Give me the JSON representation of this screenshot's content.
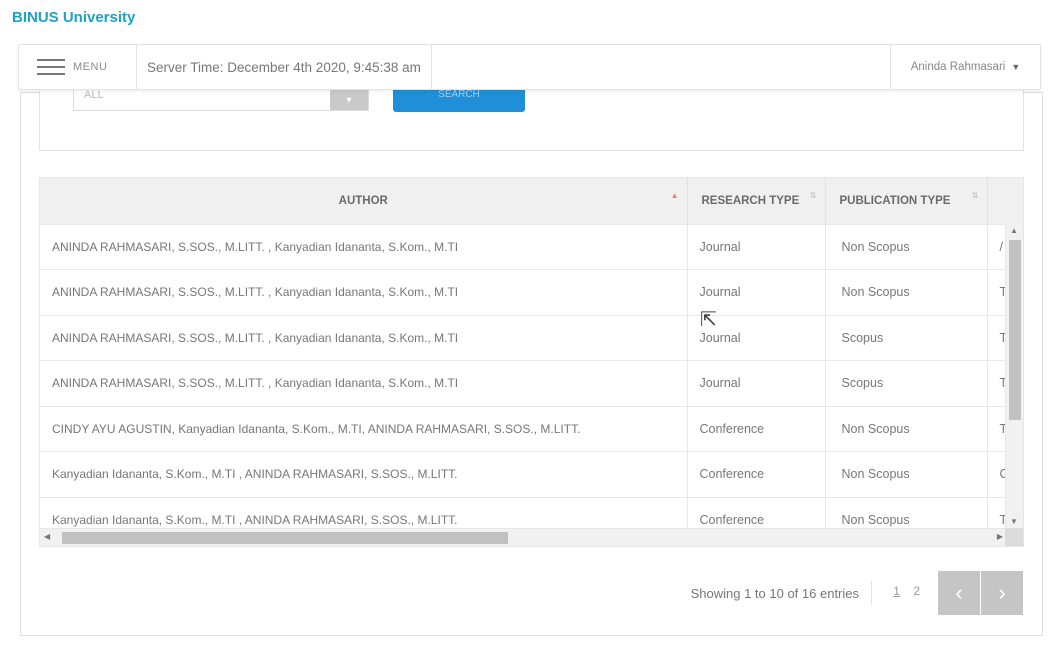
{
  "brand": {
    "name": "BINUS University"
  },
  "topbar": {
    "menu_label": "MENU",
    "server_time": "Server Time: December 4th 2020, 9:45:38 am",
    "user_name": "Aninda Rahmasari",
    "caret": "▼"
  },
  "filter": {
    "select_value": "ALL",
    "select_arrow": "▾",
    "search_label": "SEARCH"
  },
  "table": {
    "columns": [
      "AUTHOR",
      "RESEARCH TYPE",
      "PUBLICATION TYPE"
    ],
    "sort_indicators": {
      "active": "▲",
      "inactive": "⇅"
    },
    "rows": [
      {
        "author": "ANINDA RAHMASARI, S.SOS., M.LITT. , Kanyadian Idananta, S.Kom., M.TI",
        "research_type": "Journal",
        "publication_type": "Non Scopus",
        "extra": "/"
      },
      {
        "author": "ANINDA RAHMASARI, S.SOS., M.LITT. , Kanyadian Idananta, S.Kom., M.TI",
        "research_type": "Journal",
        "publication_type": "Non Scopus",
        "extra": "T"
      },
      {
        "author": "ANINDA RAHMASARI, S.SOS., M.LITT. , Kanyadian Idananta, S.Kom., M.TI",
        "research_type": "Journal",
        "publication_type": "Scopus",
        "extra": "T"
      },
      {
        "author": "ANINDA RAHMASARI, S.SOS., M.LITT. , Kanyadian Idananta, S.Kom., M.TI",
        "research_type": "Journal",
        "publication_type": "Scopus",
        "extra": "T"
      },
      {
        "author": "CINDY AYU AGUSTIN, Kanyadian Idananta, S.Kom., M.TI, ANINDA RAHMASARI, S.SOS., M.LITT.",
        "research_type": "Conference",
        "publication_type": "Non Scopus",
        "extra": "T"
      },
      {
        "author": "Kanyadian Idananta, S.Kom., M.TI , ANINDA RAHMASARI, S.SOS., M.LITT.",
        "research_type": "Conference",
        "publication_type": "Non Scopus",
        "extra": "C"
      },
      {
        "author": "Kanyadian Idananta, S.Kom., M.TI , ANINDA RAHMASARI, S.SOS., M.LITT.",
        "research_type": "Conference",
        "publication_type": "Non Scopus",
        "extra": "T"
      }
    ],
    "scroll_arrows": {
      "up": "▲",
      "down": "▼",
      "left": "◀",
      "right": "▶"
    }
  },
  "footer": {
    "entries_text": "Showing 1 to 10 of 16 entries",
    "pages": [
      "1",
      "2"
    ],
    "prev": "‹",
    "next": "›"
  },
  "cursor": {
    "glyph": "⇱"
  }
}
